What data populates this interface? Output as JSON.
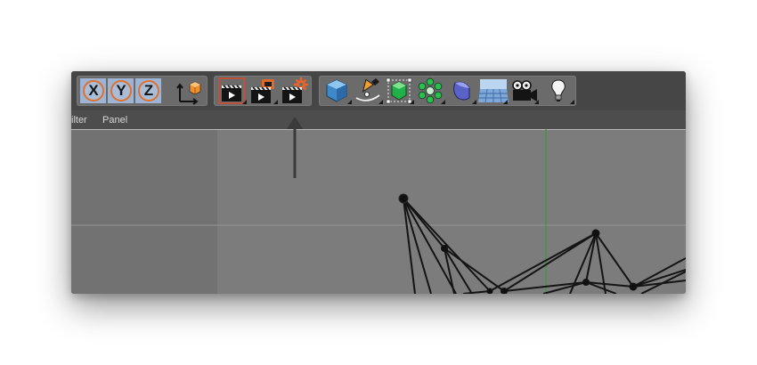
{
  "toolbar": {
    "groups": [
      {
        "name": "coordinate-system",
        "buttons": [
          {
            "icon": "x-axis-lock-icon",
            "label": "X"
          },
          {
            "icon": "y-axis-lock-icon",
            "label": "Y"
          },
          {
            "icon": "z-axis-lock-icon",
            "label": "Z"
          },
          {
            "icon": "coordinate-system-icon"
          }
        ]
      },
      {
        "name": "render",
        "buttons": [
          {
            "icon": "render-view-icon"
          },
          {
            "icon": "render-to-picture-viewer-icon"
          },
          {
            "icon": "render-settings-icon"
          }
        ]
      },
      {
        "name": "objects",
        "buttons": [
          {
            "icon": "cube-primitive-icon"
          },
          {
            "icon": "pen-spline-icon"
          },
          {
            "icon": "subdivision-surface-icon"
          },
          {
            "icon": "cloner-mograph-icon"
          },
          {
            "icon": "deformer-bend-icon"
          },
          {
            "icon": "floor-environment-icon"
          },
          {
            "icon": "camera-icon"
          },
          {
            "icon": "light-bulb-icon"
          }
        ]
      }
    ]
  },
  "menu": {
    "items": [
      "ilter",
      "Panel"
    ]
  },
  "colors": {
    "accent_orange": "#e0702c",
    "coord_blue": "#9db4d4",
    "toolbar_bg": "#464646",
    "viewport_bg": "#6f6f6f",
    "y_axis_green": "#2e9d2e"
  }
}
